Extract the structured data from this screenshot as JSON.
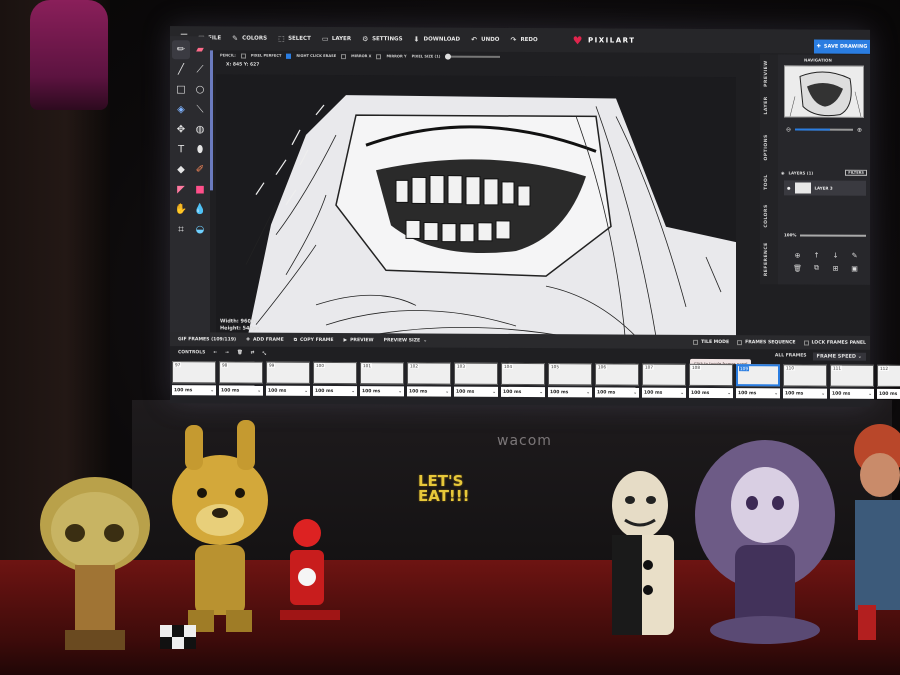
{
  "app": {
    "logo_text": "PIXILART",
    "menu": [
      "FILE",
      "COLORS",
      "SELECT",
      "LAYER",
      "SETTINGS",
      "DOWNLOAD",
      "UNDO",
      "REDO"
    ],
    "save_button": "SAVE DRAWING"
  },
  "options_bar": {
    "pencil_label": "PENCIL:",
    "pixel_perfect": "PIXEL PERFECT",
    "right_click_erase": "RIGHT CLICK ERASE",
    "mirror_x": "MIRROR X",
    "mirror_y": "MIRROR Y",
    "pixel_size": "PIXEL SIZE (1)"
  },
  "cursor_coords": "X: 845 Y: 627",
  "canvas_dims": {
    "width": "Width: 960px",
    "height": "Height: 540px"
  },
  "right_panel": {
    "tabs": [
      "PREVIEW",
      "LAYER",
      "OPTIONS",
      "TOOL",
      "COLORS",
      "REFERENCE"
    ],
    "navigation_title": "NAVIGATION",
    "layers_label": "LAYERS (1)",
    "filters_label": "FILTERS",
    "layer_name": "LAYER 3",
    "opacity": "100%"
  },
  "frames_bar": {
    "gif_frames": "GIF FRAMES (109/119)",
    "add_frame": "ADD FRAME",
    "copy_frame": "COPY FRAME",
    "preview": "PREVIEW",
    "preview_size": "PREVIEW SIZE",
    "tile_mode": "TILE MODE",
    "frames_sequence": "FRAMES SEQUENCE",
    "lock_frames_panel": "LOCK FRAMES PANEL",
    "tooltip": "Click to toggle frames panel"
  },
  "controls": {
    "label": "CONTROLS",
    "all_frames": "ALL FRAMES",
    "frame_speed": "FRAME SPEED"
  },
  "frames": [
    {
      "num": "97",
      "ms": "100 ms"
    },
    {
      "num": "98",
      "ms": "100 ms"
    },
    {
      "num": "99",
      "ms": "100 ms"
    },
    {
      "num": "100",
      "ms": "100 ms"
    },
    {
      "num": "101",
      "ms": "100 ms"
    },
    {
      "num": "102",
      "ms": "100 ms"
    },
    {
      "num": "103",
      "ms": "100 ms"
    },
    {
      "num": "104",
      "ms": "100 ms"
    },
    {
      "num": "105",
      "ms": "100 ms"
    },
    {
      "num": "106",
      "ms": "100 ms"
    },
    {
      "num": "107",
      "ms": "100 ms"
    },
    {
      "num": "108",
      "ms": "100 ms"
    },
    {
      "num": "109",
      "ms": "100 ms"
    },
    {
      "num": "110",
      "ms": "100 ms"
    },
    {
      "num": "111",
      "ms": "100 ms"
    },
    {
      "num": "112",
      "ms": "100 ms"
    }
  ],
  "active_frame": "109",
  "monitor_brand": "wacom",
  "figure_sign": [
    "LET'S",
    "EAT!!!"
  ],
  "colors": {
    "accent": "#2a7de1",
    "logo_heart": "#e0254d",
    "desk": "#6e1412"
  }
}
